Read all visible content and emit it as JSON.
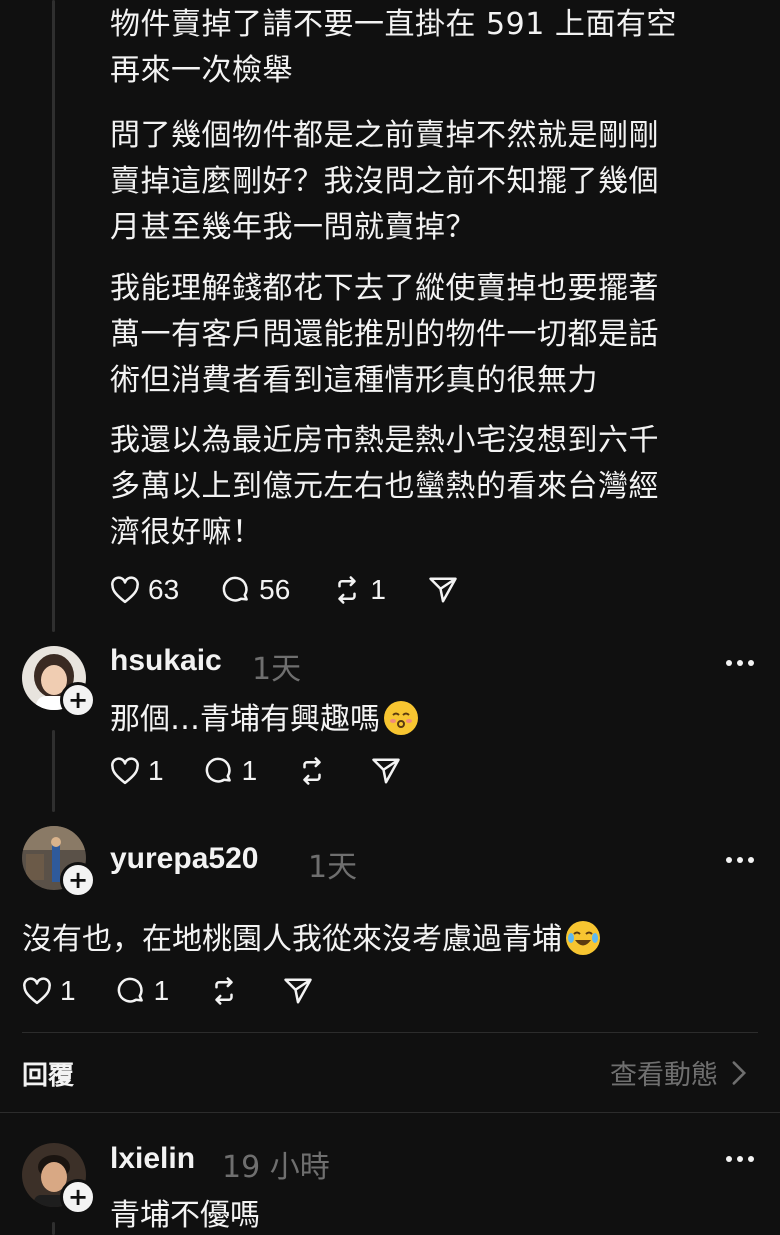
{
  "post": {
    "paragraphs": [
      [
        "物件賣掉了請不要一直掛在 591 上面有空",
        "再來一次檢舉"
      ],
      [
        "問了幾個物件都是之前賣掉不然就是剛剛",
        "賣掉這麼剛好？我沒問之前不知擺了幾個",
        "月甚至幾年我一問就賣掉？"
      ],
      [
        "我能理解錢都花下去了縱使賣掉也要擺著",
        "萬一有客戶問還能推別的物件一切都是話",
        "術但消費者看到這種情形真的很無力"
      ],
      [
        "我還以為最近房市熱是熱小宅沒想到六千",
        "多萬以上到億元左右也蠻熱的看來台灣經",
        "濟很好嘛！"
      ]
    ],
    "likes": "63",
    "comments": "56",
    "reposts": "1"
  },
  "replies": [
    {
      "username": "hsukaic",
      "time": "1天",
      "text": "那個…青埔有興趣嗎",
      "emoji": "kissing-face-icon",
      "likes": "1",
      "comments": "1"
    },
    {
      "username": "yurepa520",
      "time": "1天",
      "text": "沒有也，在地桃園人我從來沒考慮過青埔",
      "emoji": "tears-of-joy-icon",
      "likes": "1",
      "comments": "1"
    },
    {
      "username": "lxielin",
      "time": "19 小時",
      "text": "青埔不優嗎"
    }
  ],
  "reply_section": {
    "label": "回覆",
    "view_activity": "查看動態"
  },
  "colors": {
    "background": "#101010",
    "text": "#f3f3f3",
    "muted": "#6f6f6f",
    "line": "#2f2f2f"
  }
}
